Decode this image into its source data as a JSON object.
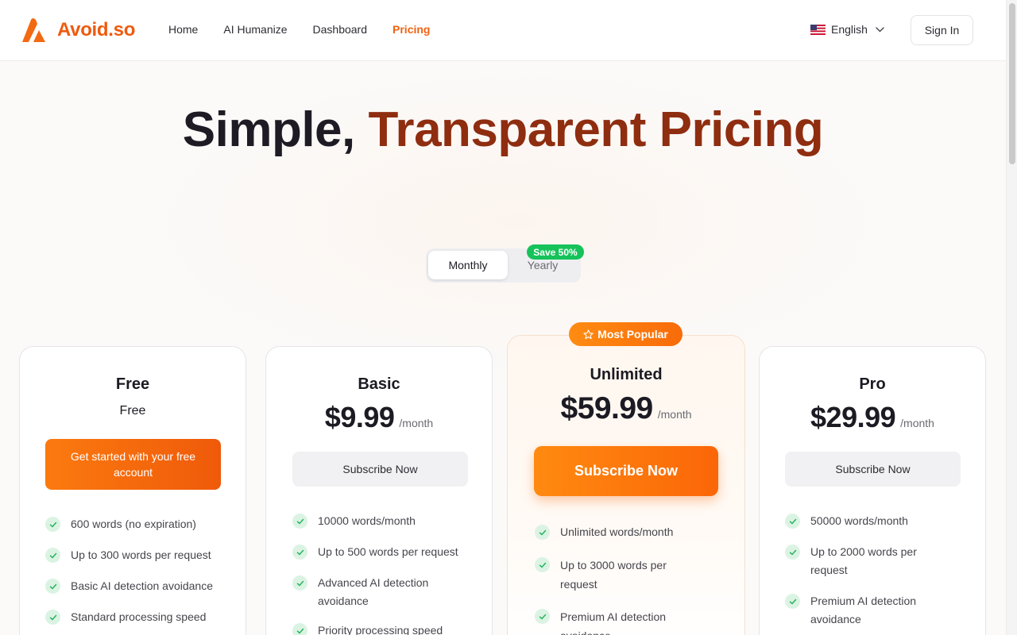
{
  "brand": {
    "name": "Avoid.so",
    "accent": "#ef5a0e"
  },
  "nav": {
    "items": [
      {
        "label": "Home"
      },
      {
        "label": "AI Humanize"
      },
      {
        "label": "Dashboard"
      },
      {
        "label": "Pricing",
        "active": true
      }
    ]
  },
  "language": {
    "label": "English",
    "flag": "us-flag-icon"
  },
  "signin_label": "Sign In",
  "hero": {
    "title_part1": "Simple,",
    "title_part2": "Transparent Pricing"
  },
  "billing_toggle": {
    "monthly": "Monthly",
    "yearly": "Yearly",
    "save_badge": "Save 50%",
    "selected": "Monthly"
  },
  "plans": [
    {
      "name": "Free",
      "price": "Free",
      "cta": "Get started with your free account",
      "features": [
        "600 words (no expiration)",
        "Up to 300 words per request",
        "Basic AI detection avoidance",
        "Standard processing speed"
      ]
    },
    {
      "name": "Basic",
      "price": "$9.99",
      "period": "/month",
      "cta": "Subscribe Now",
      "features": [
        "10000 words/month",
        "Up to 500 words per request",
        "Advanced AI detection avoidance",
        "Priority processing speed"
      ]
    },
    {
      "name": "Unlimited",
      "badge": "Most Popular",
      "price": "$59.99",
      "period": "/month",
      "cta": "Subscribe Now",
      "features": [
        "Unlimited words/month",
        "Up to 3000 words per request",
        "Premium AI detection avoidance"
      ]
    },
    {
      "name": "Pro",
      "price": "$29.99",
      "period": "/month",
      "cta": "Subscribe Now",
      "features": [
        "50000 words/month",
        "Up to 2000 words per request",
        "Premium AI detection avoidance"
      ]
    }
  ]
}
